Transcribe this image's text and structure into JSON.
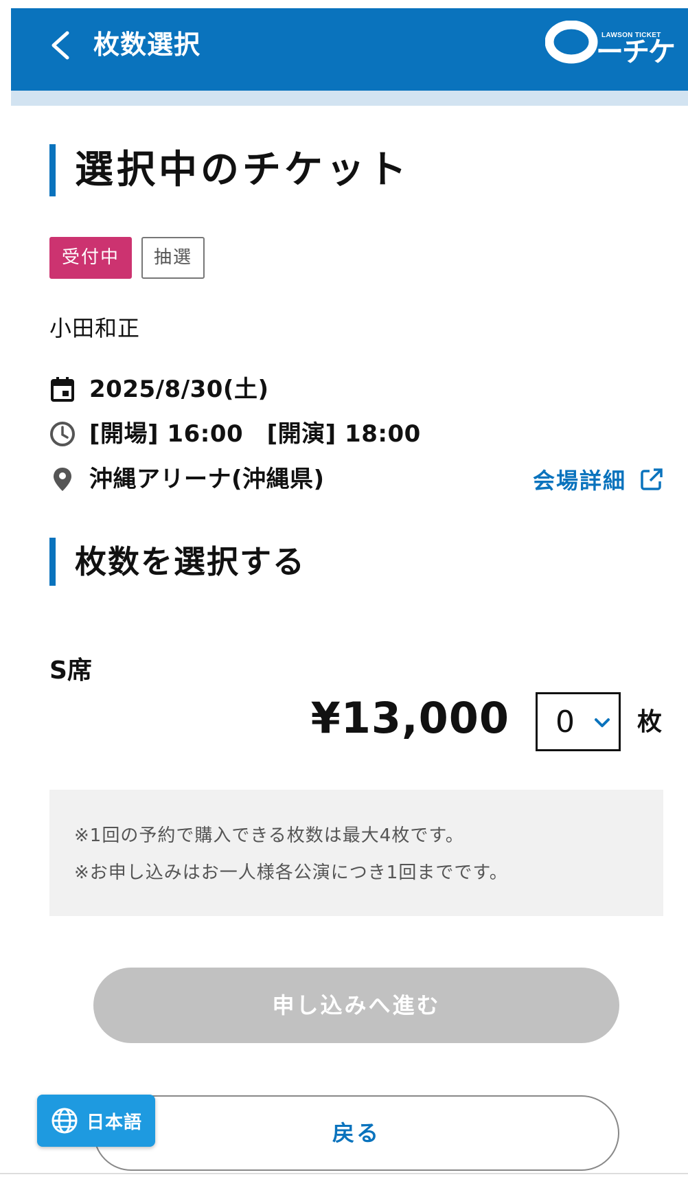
{
  "header": {
    "title": "枚数選択",
    "logo_subtitle": "LAWSON TICKET",
    "logo_text": "ーチケ",
    "bg_color": "#0a73bd"
  },
  "ticket_section": {
    "heading": "選択中のチケット",
    "badges": [
      {
        "label": "受付中",
        "color": "#cc3370"
      },
      {
        "label": "抽選"
      }
    ],
    "artist": "小田和正",
    "date": "2025/8/30(土)",
    "time": "[開場] 16:00　[開演] 18:00",
    "venue": "沖縄アリーナ(沖縄県)",
    "venue_link": "会場詳細",
    "icons": [
      "calendar-icon",
      "clock-icon",
      "location-pin-icon",
      "external-link-icon"
    ]
  },
  "quantity_section": {
    "heading": "枚数を選択する",
    "seat_type": "S席",
    "price": "¥13,000",
    "quantity": "0",
    "unit": "枚"
  },
  "notes": [
    "※1回の予約で購入できる枚数は最大4枚です。",
    "※お申し込みはお一人様各公演につき1回までです。"
  ],
  "buttons": {
    "apply": "申し込みへ進む",
    "back": "戻る"
  },
  "language": {
    "label": "日本語",
    "icon": "globe-icon"
  }
}
